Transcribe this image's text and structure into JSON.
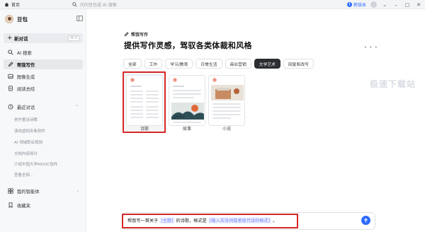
{
  "topbar": {
    "tab_label": "首页",
    "search_placeholder": "问问豆包或 AI 搜索",
    "new_version": "新版本",
    "new_version_badge": "!"
  },
  "sidebar": {
    "user_name": "豆包",
    "new_chat": "新对话",
    "new_chat_shortcut": "⌘ K",
    "nav": [
      {
        "label": "AI 搜索",
        "icon": "search-icon"
      },
      {
        "label": "帮我写作",
        "icon": "pen-icon",
        "active": true
      },
      {
        "label": "图像生成",
        "icon": "image-icon"
      },
      {
        "label": "阅读总结",
        "icon": "document-icon"
      }
    ],
    "recent_title": "最近对话",
    "recent": [
      "创作童话诗歌",
      "演说虚拟形象软件",
      "AI 领域职业规划",
      "文档内容探讨",
      "介绍中国大学MOOC软件",
      "查看全部..."
    ],
    "agents": "我的智能体",
    "favorites": "收藏夹"
  },
  "main": {
    "tag": "帮我写作",
    "title": "提供写作灵感，驾驭各类体裁和风格",
    "more": "• • •",
    "tabs": [
      "全部",
      "工作",
      "学习/教育",
      "日常生活",
      "商业营销",
      "文学艺术",
      "回复和改写"
    ],
    "active_tab": "文学艺术",
    "cards": [
      {
        "label": "诗歌",
        "selected": true
      },
      {
        "label": "故事"
      },
      {
        "label": "小说"
      }
    ],
    "watermark": "极速下载站"
  },
  "composer": {
    "prefix": "帮我写一首关于",
    "slot1": "[主题]",
    "middle": "的诗歌，格式是",
    "slot2": "[输入古诗词或者现代诗的格式]",
    "suffix": "。"
  },
  "colors": {
    "accent": "#2f6bff",
    "highlight": "#d62828",
    "sidebar_bg": "#f7f8fa"
  }
}
